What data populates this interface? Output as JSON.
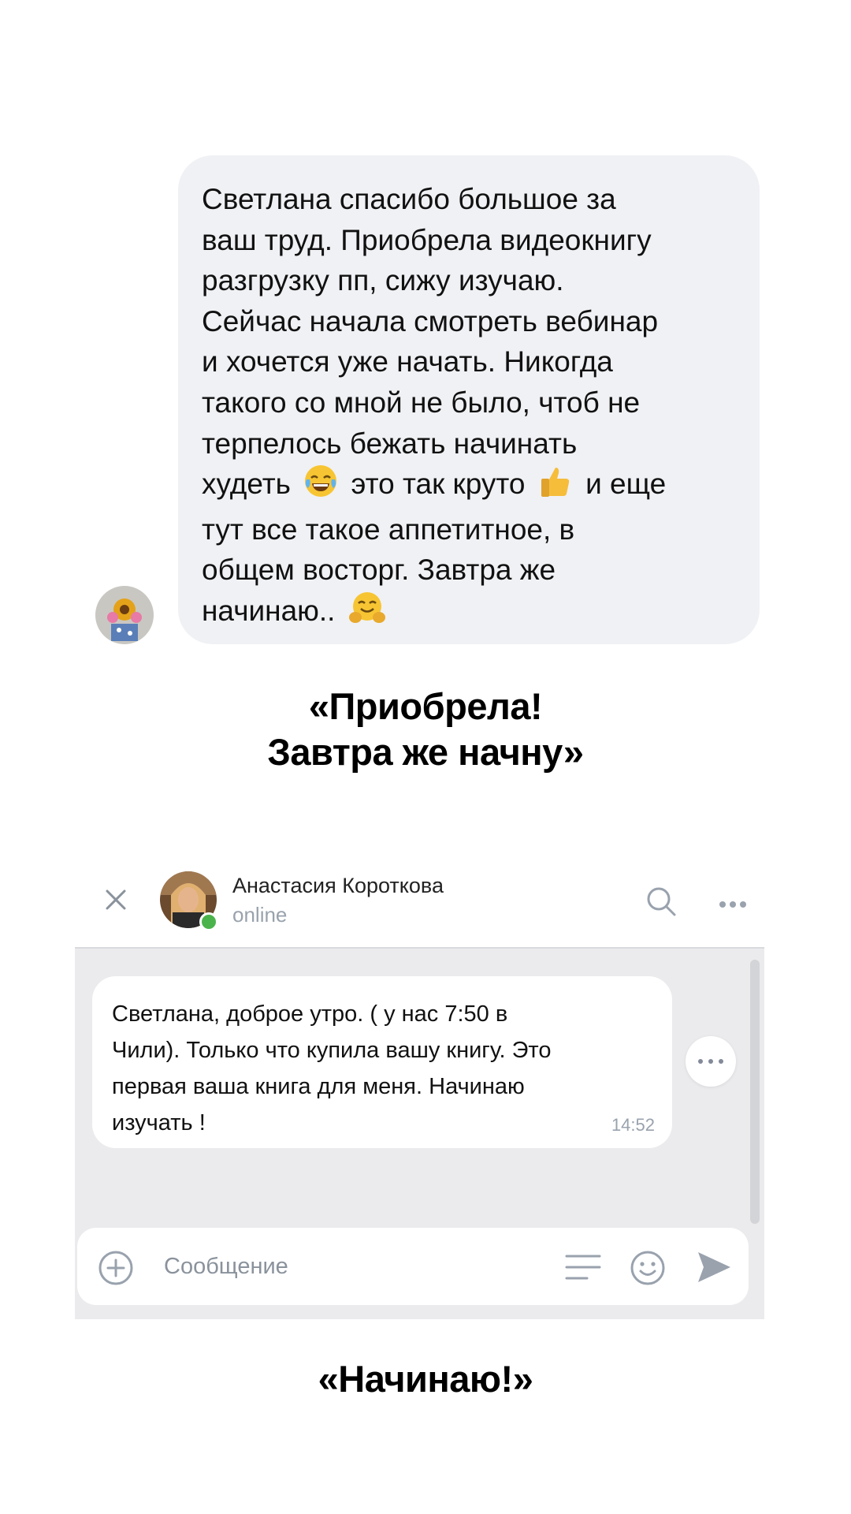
{
  "review1": {
    "text_lines": [
      "Светлана спасибо большое за",
      "ваш труд. Приобрела видеокнигу",
      "разгрузку пп, сижу изучаю.",
      "Сейчас начала смотреть вебинар",
      "и хочется уже начать. Никогда",
      "такого со мной не было, чтоб не",
      "терпелось бежать начинать"
    ],
    "line8_a": "худеть",
    "line8_b": "это так круто",
    "line8_c": "и еще",
    "line9": "тут все такое аппетитное, в",
    "line10": "общем восторг. Завтра же",
    "line11": "начинаю..",
    "emojis": [
      "laughing-tears-emoji",
      "thumbs-up-emoji",
      "hugging-face-emoji"
    ]
  },
  "caption1": {
    "line1": "«Приобрела!",
    "line2": "Завтра же начну»"
  },
  "chat": {
    "contact": {
      "name": "Анастасия Короткова",
      "status": "online"
    },
    "message": {
      "lines": [
        "Светлана, доброе утро. ( у нас 7:50 в",
        "Чили). Только что купила вашу книгу. Это",
        "первая ваша книга для меня. Начинаю",
        "изучать !"
      ],
      "time": "14:52"
    },
    "composer": {
      "placeholder": "Сообщение"
    },
    "colors": {
      "online": "#4bb34b",
      "icon": "#99a2ad",
      "background": "#ebebed"
    }
  },
  "caption2": "«Начинаю!»"
}
